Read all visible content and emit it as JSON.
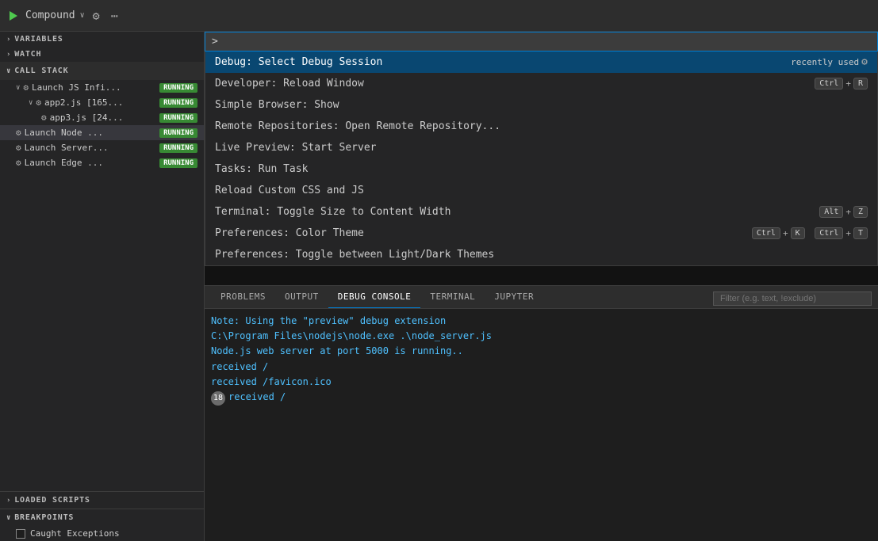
{
  "topbar": {
    "compound_label": "Compound",
    "chevron": "∨",
    "gear_icon": "⚙",
    "more_icon": "⋯"
  },
  "sidebar": {
    "variables_label": "VARIABLES",
    "watch_label": "WATCH",
    "call_stack_label": "CALL STACK",
    "items": [
      {
        "name": "Launch JS Infi...",
        "badge": "RUNNING",
        "indent": "indent1",
        "has_arrow": true,
        "arrow": "∨",
        "icon": "⚙"
      },
      {
        "name": "app2.js [165...",
        "badge": "RUNNING",
        "indent": "indent2",
        "has_arrow": true,
        "arrow": "∨",
        "icon": "⚙"
      },
      {
        "name": "app3.js [24...",
        "badge": "RUNNING",
        "indent": "indent3",
        "icon": "⚙"
      },
      {
        "name": "Launch Node ...",
        "badge": "RUNNING",
        "indent": "indent1",
        "icon": "⚙",
        "selected": true
      },
      {
        "name": "Launch Server...",
        "badge": "RUNNING",
        "indent": "indent1",
        "icon": "⚙"
      },
      {
        "name": "Launch Edge ...",
        "badge": "RUNNING",
        "indent": "indent1",
        "icon": "⚙"
      }
    ],
    "loaded_scripts_label": "LOADED SCRIPTS",
    "breakpoints_label": "BREAKPOINTS",
    "caught_exceptions_label": "Caught Exceptions"
  },
  "command_palette": {
    "input_value": ">|",
    "items": [
      {
        "label": "Debug: Select Debug Session",
        "shortcut_label": "recently used",
        "has_settings": true,
        "active": true
      },
      {
        "label": "Developer: Reload Window",
        "shortcut_keys": [
          "Ctrl",
          "+",
          "R"
        ]
      },
      {
        "label": "Simple Browser: Show"
      },
      {
        "label": "Remote Repositories: Open Remote Repository..."
      },
      {
        "label": "Live Preview: Start Server"
      },
      {
        "label": "Tasks: Run Task"
      },
      {
        "label": "Reload Custom CSS and JS"
      },
      {
        "label": "Terminal: Toggle Size to Content Width",
        "shortcut_keys": [
          "Alt",
          "+",
          "Z"
        ]
      },
      {
        "label": "Preferences: Color Theme",
        "shortcut_keys2": [
          "Ctrl",
          "+",
          "K"
        ],
        "shortcut_keys3": [
          "Ctrl",
          "+",
          "T"
        ]
      },
      {
        "label": "Preferences: Toggle between Light/Dark Themes"
      }
    ]
  },
  "panel": {
    "tabs": [
      "PROBLEMS",
      "OUTPUT",
      "DEBUG CONSOLE",
      "TERMINAL",
      "JUPYTER"
    ],
    "active_tab": "DEBUG CONSOLE",
    "filter_placeholder": "Filter (e.g. text, !exclude)",
    "console_lines": [
      {
        "text": "Note: Using the \"preview\" debug extension",
        "badge": null
      },
      {
        "text": "C:\\Program Files\\nodejs\\node.exe .\\node_server.js",
        "badge": null
      },
      {
        "text": "Node.js web server at port 5000 is running..",
        "badge": null
      },
      {
        "text": "received /",
        "badge": null
      },
      {
        "text": "received /favicon.ico",
        "badge": null
      },
      {
        "text": "received /",
        "badge": "18"
      }
    ]
  }
}
